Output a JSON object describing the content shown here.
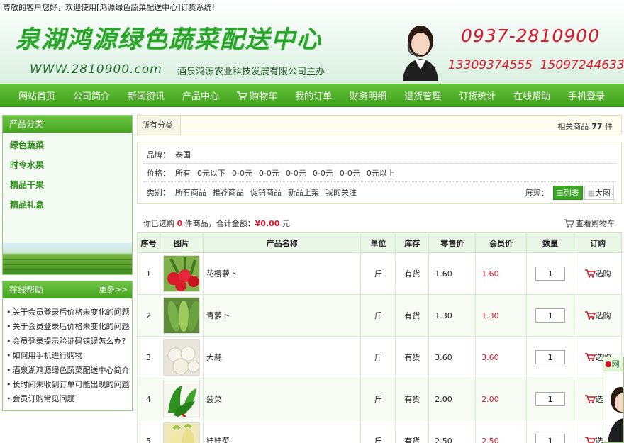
{
  "header": {
    "welcome": "尊敬的客户您好，欢迎使用[鸿源绿色蔬菜配送中心]订货系统!",
    "title": "泉湖鸿源绿色蔬菜配送中心",
    "url": "WWW.2810900.com",
    "company": "酒泉鸿源农业科技发展有限公司主办",
    "phone_main": "0937-2810900",
    "phone_sub": "13309374555  15097244633"
  },
  "nav": [
    "网站首页",
    "公司简介",
    "新闻资讯",
    "产品中心",
    "购物车",
    "我的订单",
    "财务明细",
    "退货管理",
    "订货统计",
    "在线帮助",
    "手机登录"
  ],
  "sidebar": {
    "category_title": "产品分类",
    "categories": [
      "绿色蔬菜",
      "时令水果",
      "精品干果",
      "精品礼盒"
    ],
    "help_title": "在线帮助",
    "help_more": "更多>>",
    "help_items": [
      "关于会员登录后价格未变化的问题",
      "关于会员登录后价格未变化的问题",
      "会员登录提示验证码错误怎么办?",
      "如何用手机进行购物",
      "酒泉湖鸿源绿色蔬菜配送中心简介",
      "长时间未收到订单可能出现的问题",
      "会员订购常见问题"
    ]
  },
  "breadcrumb": {
    "tab": "所有分类",
    "count_label": "相关商品",
    "count": "77",
    "count_unit": "件"
  },
  "filter": {
    "brand_label": "品牌：",
    "brands": [
      "泰国"
    ],
    "price_label": "价格：",
    "prices": [
      "所有",
      "0元以下",
      "0-0元",
      "0-0元",
      "0-0元",
      "0-0元",
      "0-0元",
      "0元以上"
    ],
    "type_label": "类别：",
    "types": [
      "所有商品",
      "推荐商品",
      "促销商品",
      "新品上架",
      "我的关注"
    ],
    "view_label": "展现：",
    "view_list": "列表",
    "view_big": "大图"
  },
  "summary": {
    "prefix": "你已选购",
    "selected": "0",
    "middle": "件商品，合计金额：",
    "amount": "¥0.00",
    "suffix": "元",
    "view_cart": "查看购物车"
  },
  "table": {
    "headers": [
      "序号",
      "图片",
      "产品名称",
      "单位",
      "库存",
      "零售价",
      "会员价",
      "数量",
      "订购"
    ],
    "rows": [
      {
        "no": "1",
        "name": "花樱萝卜",
        "unit": "斤",
        "stock": "有货",
        "price": "1.60",
        "member_price": "1.60",
        "qty": "1",
        "buy": "选购"
      },
      {
        "no": "2",
        "name": "青萝卜",
        "unit": "斤",
        "stock": "有货",
        "price": "1.30",
        "member_price": "1.30",
        "qty": "1",
        "buy": "选购"
      },
      {
        "no": "3",
        "name": "大蒜",
        "unit": "斤",
        "stock": "有货",
        "price": "3.60",
        "member_price": "3.60",
        "qty": "1",
        "buy": "选购"
      },
      {
        "no": "4",
        "name": "菠菜",
        "unit": "斤",
        "stock": "有货",
        "price": "2.00",
        "member_price": "2.00",
        "qty": "1",
        "buy": "选购"
      },
      {
        "no": "5",
        "name": "娃娃菜",
        "unit": "斤",
        "stock": "有货",
        "price": "2.50",
        "member_price": "2.50",
        "qty": "1",
        "buy": "选购"
      }
    ]
  },
  "chat": {
    "label": "网"
  },
  "colors": {
    "brand_green": "#3fa11c",
    "price_red": "#e0142a"
  }
}
